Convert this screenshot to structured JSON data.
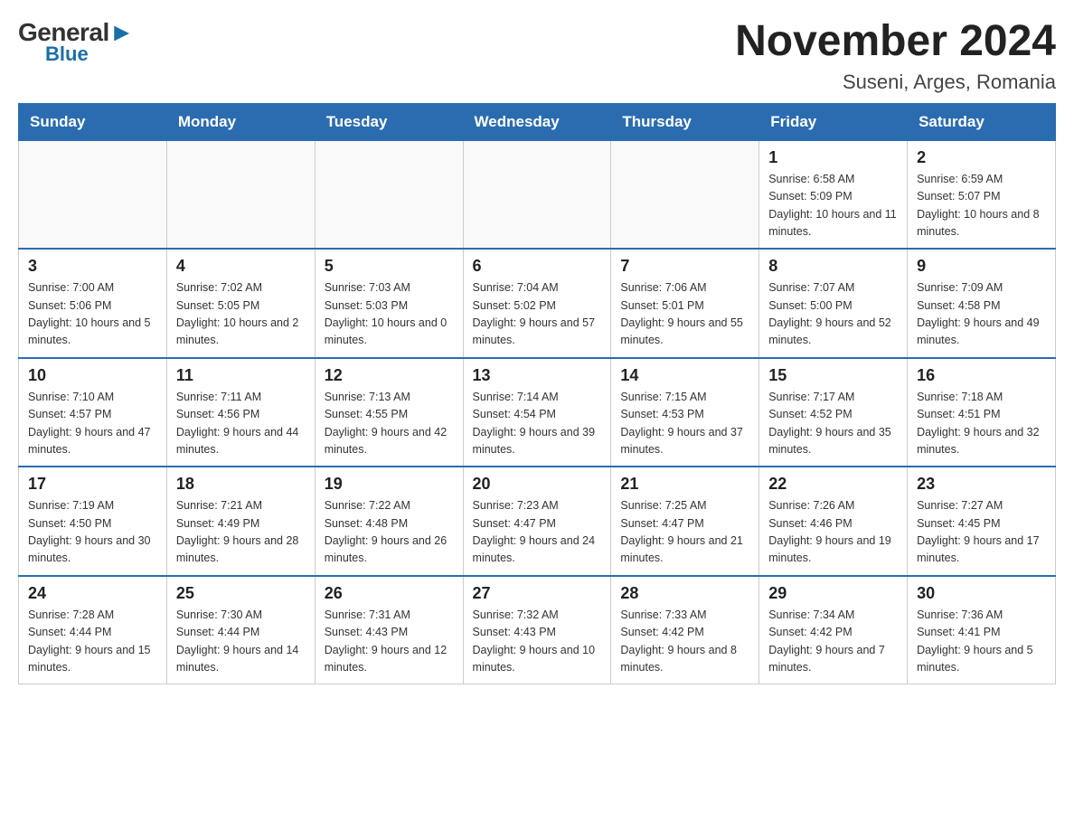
{
  "header": {
    "logo_general": "General",
    "logo_blue": "Blue",
    "title": "November 2024",
    "subtitle": "Suseni, Arges, Romania"
  },
  "days_of_week": [
    "Sunday",
    "Monday",
    "Tuesday",
    "Wednesday",
    "Thursday",
    "Friday",
    "Saturday"
  ],
  "weeks": [
    [
      {
        "day": "",
        "info": ""
      },
      {
        "day": "",
        "info": ""
      },
      {
        "day": "",
        "info": ""
      },
      {
        "day": "",
        "info": ""
      },
      {
        "day": "",
        "info": ""
      },
      {
        "day": "1",
        "info": "Sunrise: 6:58 AM\nSunset: 5:09 PM\nDaylight: 10 hours and 11 minutes."
      },
      {
        "day": "2",
        "info": "Sunrise: 6:59 AM\nSunset: 5:07 PM\nDaylight: 10 hours and 8 minutes."
      }
    ],
    [
      {
        "day": "3",
        "info": "Sunrise: 7:00 AM\nSunset: 5:06 PM\nDaylight: 10 hours and 5 minutes."
      },
      {
        "day": "4",
        "info": "Sunrise: 7:02 AM\nSunset: 5:05 PM\nDaylight: 10 hours and 2 minutes."
      },
      {
        "day": "5",
        "info": "Sunrise: 7:03 AM\nSunset: 5:03 PM\nDaylight: 10 hours and 0 minutes."
      },
      {
        "day": "6",
        "info": "Sunrise: 7:04 AM\nSunset: 5:02 PM\nDaylight: 9 hours and 57 minutes."
      },
      {
        "day": "7",
        "info": "Sunrise: 7:06 AM\nSunset: 5:01 PM\nDaylight: 9 hours and 55 minutes."
      },
      {
        "day": "8",
        "info": "Sunrise: 7:07 AM\nSunset: 5:00 PM\nDaylight: 9 hours and 52 minutes."
      },
      {
        "day": "9",
        "info": "Sunrise: 7:09 AM\nSunset: 4:58 PM\nDaylight: 9 hours and 49 minutes."
      }
    ],
    [
      {
        "day": "10",
        "info": "Sunrise: 7:10 AM\nSunset: 4:57 PM\nDaylight: 9 hours and 47 minutes."
      },
      {
        "day": "11",
        "info": "Sunrise: 7:11 AM\nSunset: 4:56 PM\nDaylight: 9 hours and 44 minutes."
      },
      {
        "day": "12",
        "info": "Sunrise: 7:13 AM\nSunset: 4:55 PM\nDaylight: 9 hours and 42 minutes."
      },
      {
        "day": "13",
        "info": "Sunrise: 7:14 AM\nSunset: 4:54 PM\nDaylight: 9 hours and 39 minutes."
      },
      {
        "day": "14",
        "info": "Sunrise: 7:15 AM\nSunset: 4:53 PM\nDaylight: 9 hours and 37 minutes."
      },
      {
        "day": "15",
        "info": "Sunrise: 7:17 AM\nSunset: 4:52 PM\nDaylight: 9 hours and 35 minutes."
      },
      {
        "day": "16",
        "info": "Sunrise: 7:18 AM\nSunset: 4:51 PM\nDaylight: 9 hours and 32 minutes."
      }
    ],
    [
      {
        "day": "17",
        "info": "Sunrise: 7:19 AM\nSunset: 4:50 PM\nDaylight: 9 hours and 30 minutes."
      },
      {
        "day": "18",
        "info": "Sunrise: 7:21 AM\nSunset: 4:49 PM\nDaylight: 9 hours and 28 minutes."
      },
      {
        "day": "19",
        "info": "Sunrise: 7:22 AM\nSunset: 4:48 PM\nDaylight: 9 hours and 26 minutes."
      },
      {
        "day": "20",
        "info": "Sunrise: 7:23 AM\nSunset: 4:47 PM\nDaylight: 9 hours and 24 minutes."
      },
      {
        "day": "21",
        "info": "Sunrise: 7:25 AM\nSunset: 4:47 PM\nDaylight: 9 hours and 21 minutes."
      },
      {
        "day": "22",
        "info": "Sunrise: 7:26 AM\nSunset: 4:46 PM\nDaylight: 9 hours and 19 minutes."
      },
      {
        "day": "23",
        "info": "Sunrise: 7:27 AM\nSunset: 4:45 PM\nDaylight: 9 hours and 17 minutes."
      }
    ],
    [
      {
        "day": "24",
        "info": "Sunrise: 7:28 AM\nSunset: 4:44 PM\nDaylight: 9 hours and 15 minutes."
      },
      {
        "day": "25",
        "info": "Sunrise: 7:30 AM\nSunset: 4:44 PM\nDaylight: 9 hours and 14 minutes."
      },
      {
        "day": "26",
        "info": "Sunrise: 7:31 AM\nSunset: 4:43 PM\nDaylight: 9 hours and 12 minutes."
      },
      {
        "day": "27",
        "info": "Sunrise: 7:32 AM\nSunset: 4:43 PM\nDaylight: 9 hours and 10 minutes."
      },
      {
        "day": "28",
        "info": "Sunrise: 7:33 AM\nSunset: 4:42 PM\nDaylight: 9 hours and 8 minutes."
      },
      {
        "day": "29",
        "info": "Sunrise: 7:34 AM\nSunset: 4:42 PM\nDaylight: 9 hours and 7 minutes."
      },
      {
        "day": "30",
        "info": "Sunrise: 7:36 AM\nSunset: 4:41 PM\nDaylight: 9 hours and 5 minutes."
      }
    ]
  ]
}
